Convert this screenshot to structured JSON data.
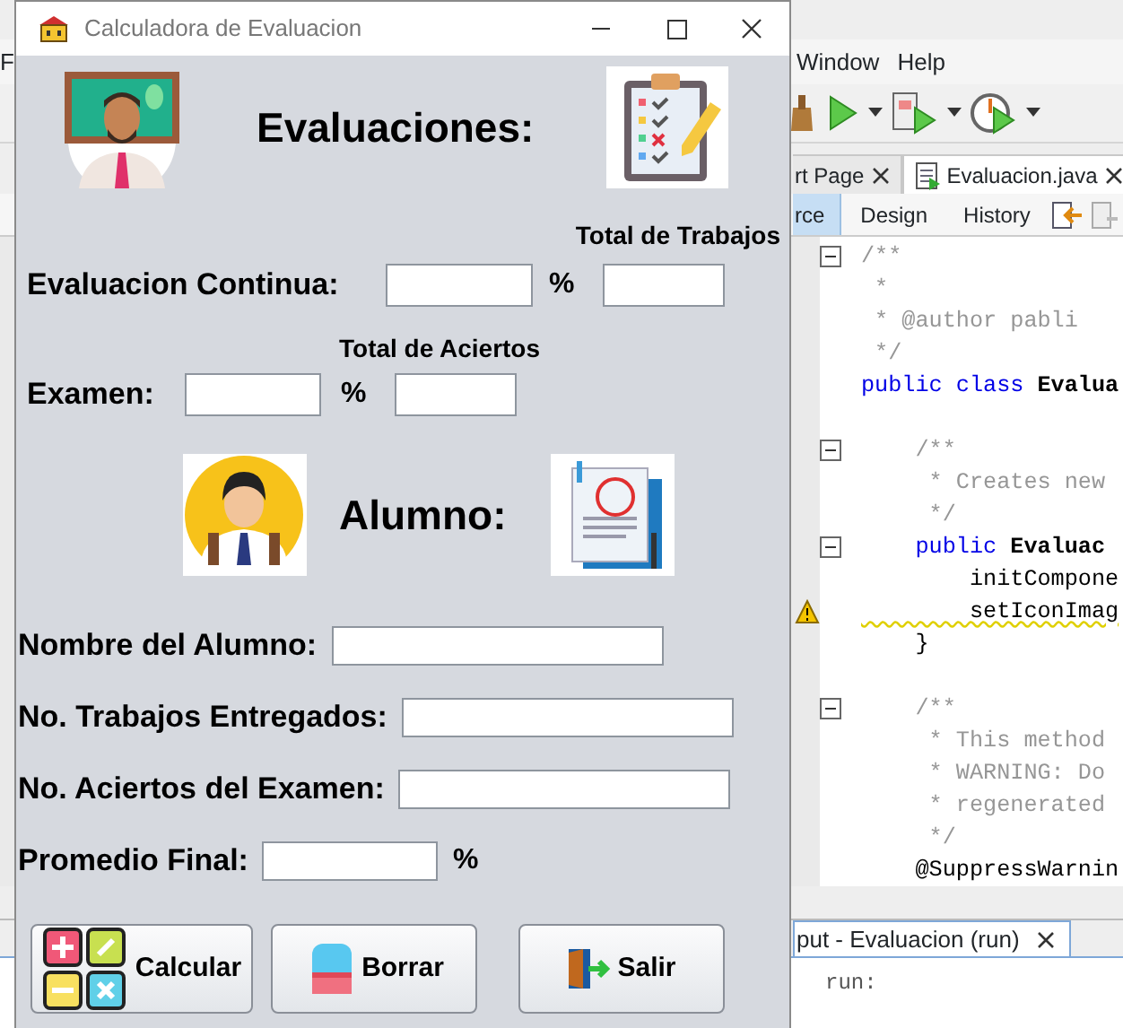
{
  "ide": {
    "menu": [
      "F",
      "Window",
      "Help"
    ],
    "tabs": [
      {
        "label": "rt Page",
        "selected": false
      },
      {
        "label": "Evaluacion.java",
        "selected": true
      }
    ],
    "views": [
      {
        "label": "rce",
        "selected": true
      },
      {
        "label": "Design",
        "selected": false
      },
      {
        "label": "History",
        "selected": false
      }
    ],
    "lines": [
      {
        "warning": false,
        "fold_handle": true,
        "parts": [
          {
            "kind": "comment",
            "text": "/**"
          }
        ]
      },
      {
        "warning": false,
        "fold_handle": false,
        "parts": [
          {
            "kind": "comment",
            "text": " *"
          }
        ]
      },
      {
        "warning": false,
        "fold_handle": false,
        "parts": [
          {
            "kind": "comment",
            "text": " * @author pabli"
          }
        ]
      },
      {
        "warning": false,
        "fold_handle": false,
        "parts": [
          {
            "kind": "comment",
            "text": " */"
          }
        ]
      },
      {
        "warning": false,
        "fold_handle": false,
        "parts": [
          {
            "kind": "keyword",
            "text": "public class "
          },
          {
            "kind": "name",
            "text": "Evalua"
          }
        ]
      },
      {
        "warning": false,
        "fold_handle": false
      },
      {
        "warning": false,
        "fold_handle": true,
        "parts": [
          {
            "kind": "comment",
            "text": "    /**"
          }
        ]
      },
      {
        "warning": false,
        "fold_handle": false,
        "parts": [
          {
            "kind": "comment",
            "text": "     * Creates new"
          }
        ]
      },
      {
        "warning": false,
        "fold_handle": false,
        "parts": [
          {
            "kind": "comment",
            "text": "     */"
          }
        ]
      },
      {
        "warning": false,
        "fold_handle": true,
        "parts": [
          {
            "kind": "keyword",
            "text": "    public "
          },
          {
            "kind": "name",
            "text": "Evaluac"
          }
        ]
      },
      {
        "warning": false,
        "fold_handle": false,
        "parts": [
          {
            "kind": "plain",
            "text": "        initCompone"
          }
        ]
      },
      {
        "warning": true,
        "fold_handle": false,
        "parts": [
          {
            "kind": "plain",
            "text": "        setIconImag"
          }
        ]
      },
      {
        "warning": false,
        "fold_handle": false,
        "parts": [
          {
            "kind": "plain",
            "text": "    }"
          }
        ]
      },
      {
        "warning": false,
        "fold_handle": false
      },
      {
        "warning": false,
        "fold_handle": true,
        "parts": [
          {
            "kind": "comment",
            "text": "    /**"
          }
        ]
      },
      {
        "warning": false,
        "fold_handle": false,
        "parts": [
          {
            "kind": "comment",
            "text": "     * This method"
          }
        ]
      },
      {
        "warning": false,
        "fold_handle": false,
        "parts": [
          {
            "kind": "comment",
            "text": "     * WARNING: Do"
          }
        ]
      },
      {
        "warning": false,
        "fold_handle": false,
        "parts": [
          {
            "kind": "comment",
            "text": "     * regenerated"
          }
        ]
      },
      {
        "warning": false,
        "fold_handle": false,
        "parts": [
          {
            "kind": "comment",
            "text": "     */"
          }
        ]
      },
      {
        "warning": false,
        "fold_handle": false,
        "parts": [
          {
            "kind": "plain",
            "text": "    @SuppressWarnin"
          }
        ]
      }
    ],
    "output": {
      "tab": "put - Evaluacion (run)",
      "text": "run:"
    }
  },
  "dialog": {
    "title": "Calculadora de Evaluacion",
    "heading": "Evaluaciones:",
    "total_trabajos_label": "Total de Trabajos",
    "continua": {
      "label": "Evaluacion Continua:",
      "percent": "%"
    },
    "total_aciertos_label": "Total de Aciertos",
    "examen": {
      "label": "Examen:",
      "percent": "%"
    },
    "alumno_heading": "Alumno:",
    "fields": [
      {
        "label": "Nombre del Alumno:"
      },
      {
        "label": "No. Trabajos Entregados:"
      },
      {
        "label": "No. Aciertos del Examen:"
      }
    ],
    "promedio": {
      "label": "Promedio Final:",
      "percent": "%"
    },
    "buttons": [
      {
        "label": "Calcular",
        "kind": "calculate"
      },
      {
        "label": "Borrar",
        "kind": "erase"
      },
      {
        "label": "Salir",
        "kind": "exit"
      }
    ]
  }
}
